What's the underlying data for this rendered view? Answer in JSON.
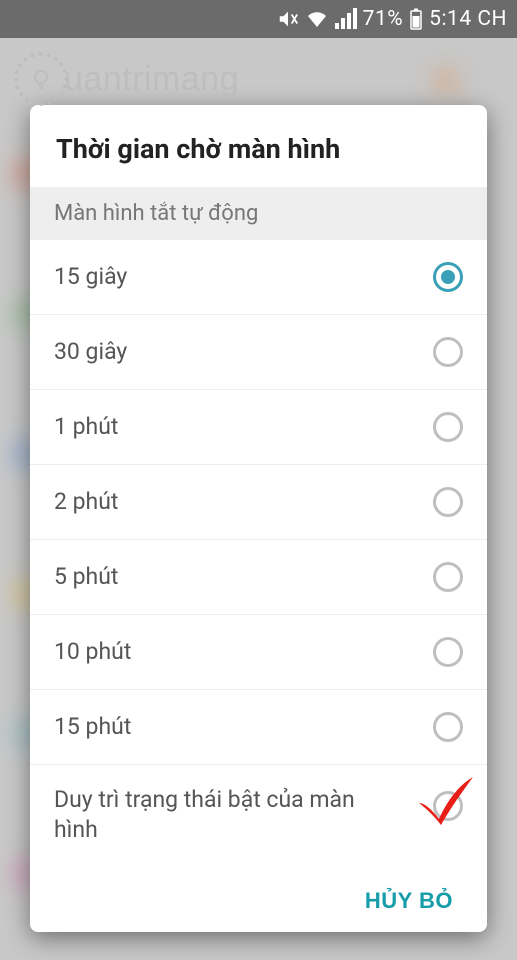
{
  "status_bar": {
    "battery_percent": "71%",
    "time": "5:14 CH"
  },
  "watermark": {
    "text": "uantrimang"
  },
  "dialog": {
    "title": "Thời gian chờ màn hình",
    "section_header": "Màn hình tắt tự động",
    "options": [
      {
        "label": "15 giây",
        "selected": true
      },
      {
        "label": "30 giây",
        "selected": false
      },
      {
        "label": "1 phút",
        "selected": false
      },
      {
        "label": "2 phút",
        "selected": false
      },
      {
        "label": "5 phút",
        "selected": false
      },
      {
        "label": "10 phút",
        "selected": false
      },
      {
        "label": "15 phút",
        "selected": false
      },
      {
        "label": "Duy trì trạng thái bật của màn hình",
        "selected": false
      }
    ],
    "cancel_label": "HỦY BỎ"
  },
  "icons": {
    "mute": "mute-icon",
    "wifi": "wifi-icon",
    "signal": "signal-icon",
    "battery": "battery-icon"
  },
  "colors": {
    "accent": "#3aa0b7",
    "cancel": "#179caa",
    "annotation_red": "#e81f17"
  }
}
